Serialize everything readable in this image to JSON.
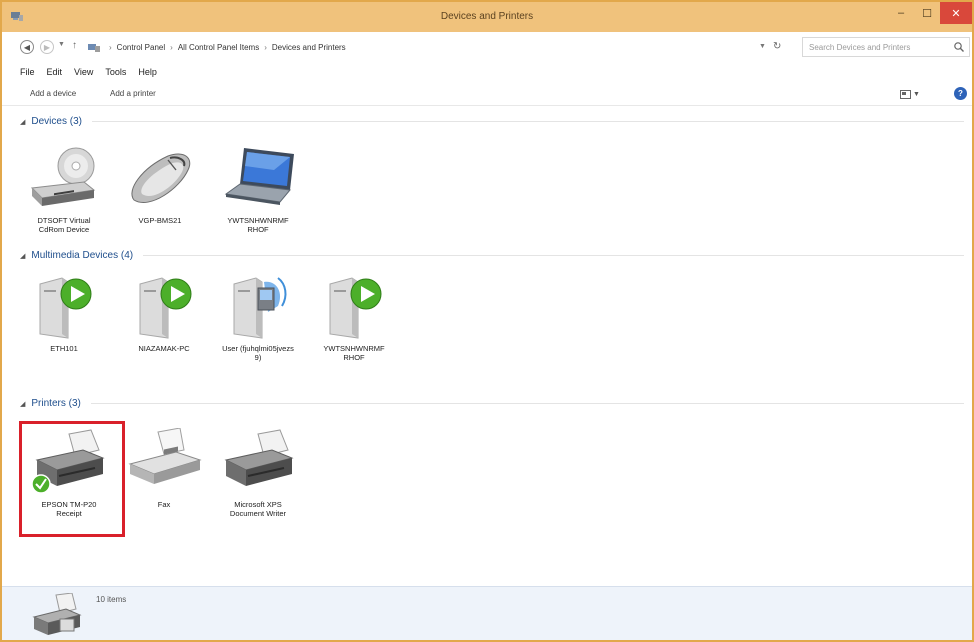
{
  "window": {
    "title": "Devices and Printers",
    "min_glyph": "–",
    "max_glyph": "☐",
    "close_glyph": "✕"
  },
  "address": {
    "crumbs": [
      "Control Panel",
      "All Control Panel Items",
      "Devices and Printers"
    ],
    "separator": "›",
    "search_placeholder": "Search Devices and Printers"
  },
  "menu": [
    "File",
    "Edit",
    "View",
    "Tools",
    "Help"
  ],
  "commands": {
    "add_device": "Add a device",
    "add_printer": "Add a printer"
  },
  "groups": {
    "devices": {
      "title": "Devices (3)",
      "items": [
        {
          "label": "DTSOFT Virtual CdRom Device",
          "icon": "cdrom-drive-icon"
        },
        {
          "label": "VGP-BMS21",
          "icon": "mouse-icon"
        },
        {
          "label": "YWTSNHWNRMF RHOF",
          "icon": "laptop-icon"
        }
      ]
    },
    "multimedia": {
      "title": "Multimedia Devices (4)",
      "items": [
        {
          "label": "ETH101",
          "icon": "media-server-play-icon"
        },
        {
          "label": "NIAZAMAK-PC",
          "icon": "media-server-play-icon"
        },
        {
          "label": "User (fjuhqlmi05jvezs 9)",
          "icon": "media-server-music-icon"
        },
        {
          "label": "YWTSNHWNRMF RHOF",
          "icon": "media-server-play-icon"
        }
      ]
    },
    "printers": {
      "title": "Printers (3)",
      "items": [
        {
          "label": "EPSON TM-P20 Receipt",
          "icon": "printer-default-icon"
        },
        {
          "label": "Fax",
          "icon": "fax-icon"
        },
        {
          "label": "Microsoft XPS Document Writer",
          "icon": "printer-icon"
        }
      ]
    }
  },
  "status": {
    "count": "10 items"
  },
  "colors": {
    "titlebar": "#f0c27c",
    "accent_blue": "#1e4e8c",
    "selection_red": "#d9202a",
    "play_green": "#4caf2a"
  }
}
